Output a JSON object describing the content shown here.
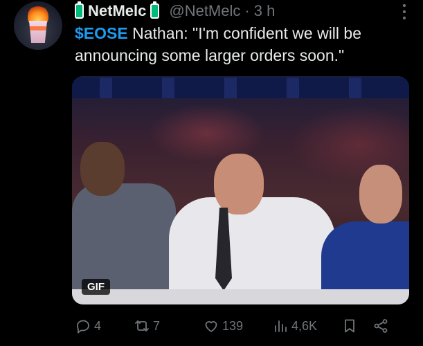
{
  "tweet": {
    "author": {
      "display_name": "NetMelc",
      "handle": "@NetMelc",
      "time_separator": "·",
      "time": "3 h",
      "badge_icon": "battery-icon",
      "avatar_icon": "burning-cup-avatar"
    },
    "text": {
      "cashtag": "$EOSE",
      "body": " Nathan: \"I'm confident we will be announcing some larger orders soon.\""
    },
    "media": {
      "type_badge": "GIF"
    },
    "actions": {
      "replies": "4",
      "retweets": "7",
      "likes": "139",
      "views": "4,6K"
    }
  },
  "colors": {
    "background": "#000000",
    "text": "#e7e9ea",
    "muted": "#71767b",
    "accent": "#1d9bf0",
    "battery": "#00ba7c"
  }
}
